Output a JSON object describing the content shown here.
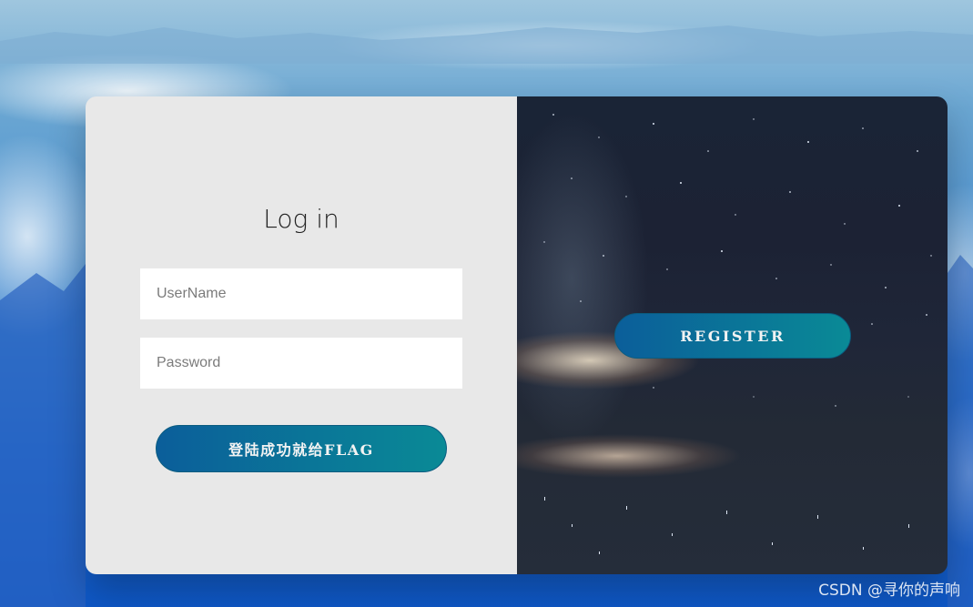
{
  "login": {
    "title": "Log in",
    "username_placeholder": "UserName",
    "password_placeholder": "Password",
    "submit_label": "登陆成功就给FLAG"
  },
  "register": {
    "button_label": "REGISTER"
  },
  "watermark": "CSDN @寻你的声响",
  "colors": {
    "panel_background": "#e8e8e8",
    "button_gradient_start": "#0b5e9a",
    "button_gradient_end": "#0a8a96",
    "night_background": "#1c2234"
  }
}
